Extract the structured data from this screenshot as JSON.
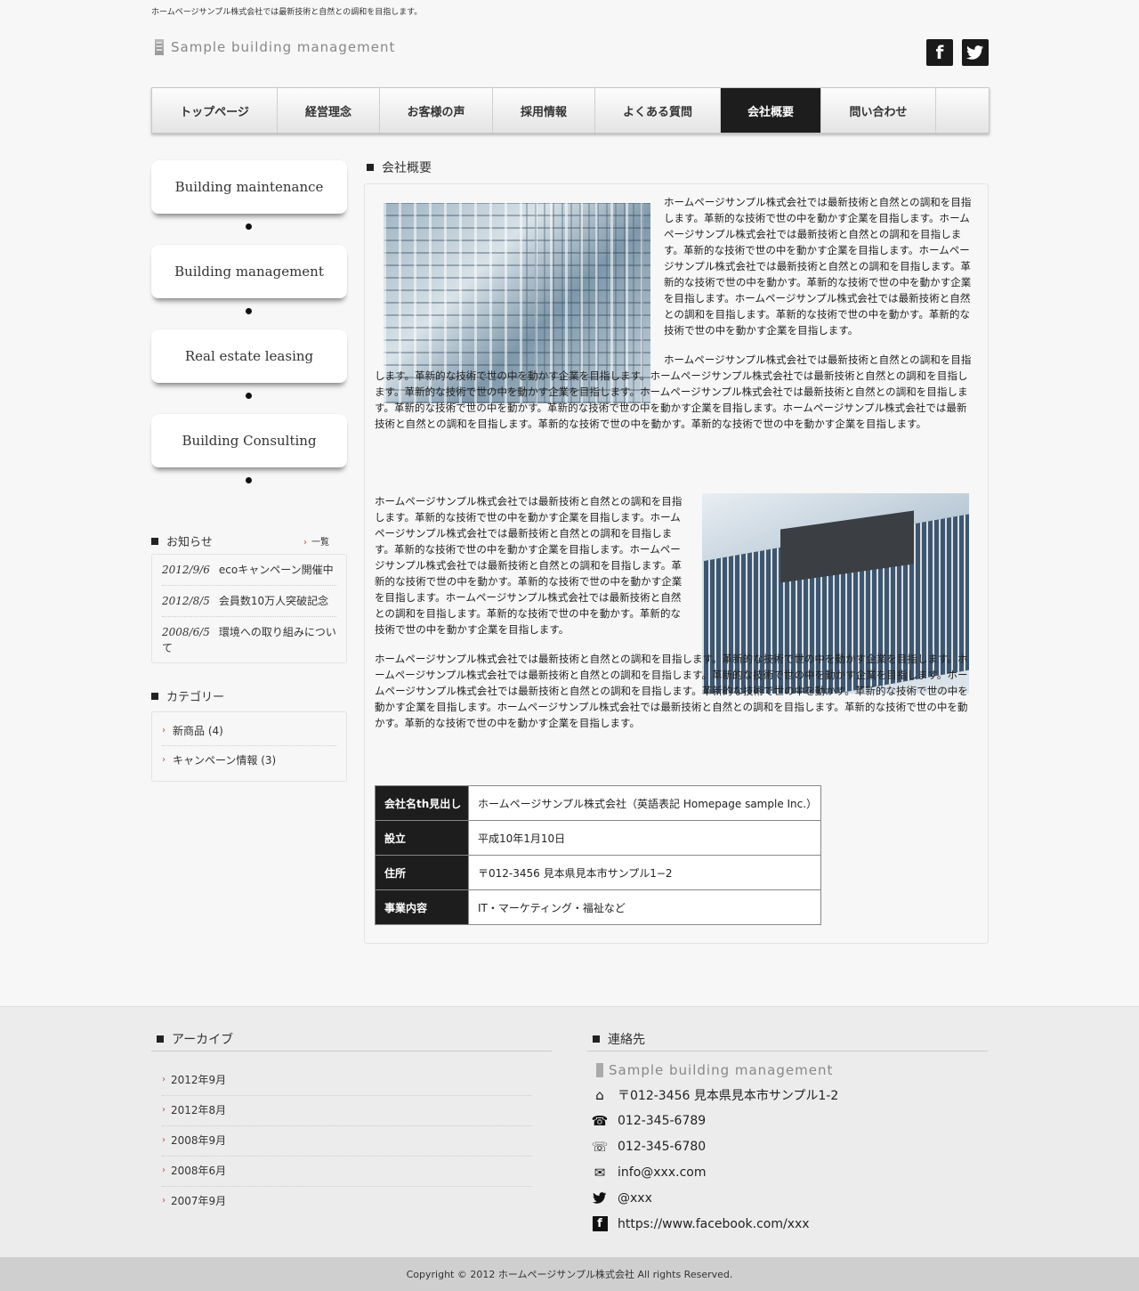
{
  "header": {
    "tagline": "ホームページサンプル株式会社では最新技術と自然との調和を目指します。",
    "logo_text": "Sample building management",
    "social": [
      "f",
      "t"
    ]
  },
  "nav": {
    "items": [
      {
        "label": "トップページ",
        "active": false
      },
      {
        "label": "経営理念",
        "active": false
      },
      {
        "label": "お客様の声",
        "active": false
      },
      {
        "label": "採用情報",
        "active": false
      },
      {
        "label": "よくある質問",
        "active": false
      },
      {
        "label": "会社概要",
        "active": true
      },
      {
        "label": "問い合わせ",
        "active": false
      }
    ]
  },
  "sidebar": {
    "services": [
      "Building maintenance",
      "Building management",
      "Real estate leasing",
      "Building Consulting"
    ],
    "news": {
      "title": "お知らせ",
      "more": "一覧",
      "items": [
        {
          "date": "2012/9/6",
          "text": "ecoキャンペーン開催中"
        },
        {
          "date": "2012/8/5",
          "text": "会員数10万人突破記念"
        },
        {
          "date": "2008/6/5",
          "text": "環境への取り組みについて"
        }
      ]
    },
    "category": {
      "title": "カテゴリー",
      "items": [
        "新商品 (4)",
        "キャンペーン情報 (3)"
      ]
    }
  },
  "main": {
    "title": "会社概要",
    "p1": "ホームページサンプル株式会社では最新技術と自然との調和を目指します。革新的な技術で世の中を動かす企業を目指します。ホームページサンプル株式会社では最新技術と自然との調和を目指します。革新的な技術で世の中を動かす企業を目指します。ホームページサンプル株式会社では最新技術と自然との調和を目指します。革新的な技術で世の中を動かす。革新的な技術で世の中を動かす企業を目指します。ホームページサンプル株式会社では最新技術と自然との調和を目指します。革新的な技術で世の中を動かす。革新的な技術で世の中を動かす企業を目指します。",
    "p2": "ホームページサンプル株式会社では最新技術と自然との調和を目指します。革新的な技術で世の中を動かす企業を目指します。ホームページサンプル株式会社では最新技術と自然との調和を目指します。革新的な技術で世の中を動かす企業を目指します。ホームページサンプル株式会社では最新技術と自然との調和を目指します。革新的な技術で世の中を動かす。革新的な技術で世の中を動かす企業を目指します。ホームページサンプル株式会社では最新技術と自然との調和を目指します。革新的な技術で世の中を動かす。革新的な技術で世の中を動かす企業を目指します。",
    "p3": "ホームページサンプル株式会社では最新技術と自然との調和を目指します。革新的な技術で世の中を動かす企業を目指します。ホームページサンプル株式会社では最新技術と自然との調和を目指します。革新的な技術で世の中を動かす企業を目指します。ホームページサンプル株式会社では最新技術と自然との調和を目指します。革新的な技術で世の中を動かす。革新的な技術で世の中を動かす企業を目指します。ホームページサンプル株式会社では最新技術と自然との調和を目指します。革新的な技術で世の中を動かす。革新的な技術で世の中を動かす企業を目指します。",
    "p4": "ホームページサンプル株式会社では最新技術と自然との調和を目指します。革新的な技術で世の中を動かす企業を目指します。ホームページサンプル株式会社では最新技術と自然との調和を目指します。革新的な技術で世の中を動かす企業を目指します。ホームページサンプル株式会社では最新技術と自然との調和を目指します。革新的な技術で世の中を動かす。革新的な技術で世の中を動かす企業を目指します。ホームページサンプル株式会社では最新技術と自然との調和を目指します。革新的な技術で世の中を動かす。革新的な技術で世の中を動かす企業を目指します。",
    "table": [
      {
        "th": "会社名th見出し",
        "td": "ホームページサンプル株式会社（英語表記 Homepage sample Inc.）"
      },
      {
        "th": "設立",
        "td": "平成10年1月10日"
      },
      {
        "th": "住所",
        "td": "〒012-3456 見本県見本市サンプル1−2"
      },
      {
        "th": "事業内容",
        "td": "IT・マーケティング・福祉など"
      }
    ]
  },
  "footer": {
    "archive": {
      "title": "アーカイブ",
      "items": [
        "2012年9月",
        "2012年8月",
        "2008年9月",
        "2008年6月",
        "2007年9月"
      ]
    },
    "contact": {
      "title": "連絡先",
      "logo_text": "Sample building management",
      "address": "〒012-3456 見本県見本市サンプル1-2",
      "tel": "012-345-6789",
      "fax": "012-345-6780",
      "email": "info@xxx.com",
      "twitter": "@xxx",
      "facebook": "https://www.facebook.com/xxx"
    },
    "copyright": "Copyright © 2012 ホームページサンプル株式会社 All rights Reserved."
  }
}
